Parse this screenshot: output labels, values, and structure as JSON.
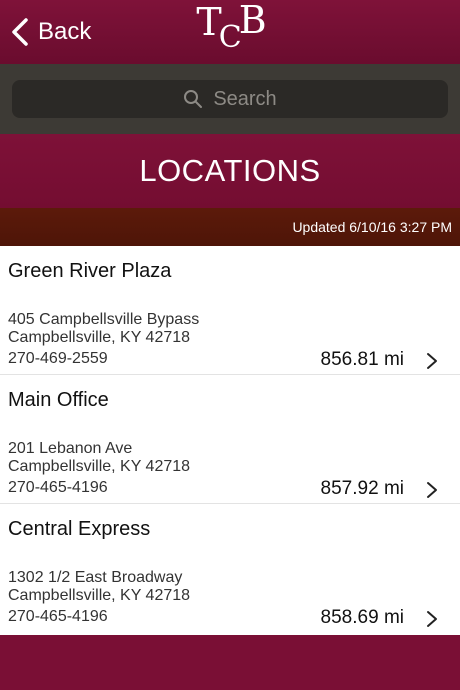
{
  "nav": {
    "back_label": "Back",
    "logo_letters": [
      "T",
      "C",
      "B"
    ]
  },
  "search": {
    "placeholder": "Search"
  },
  "title": "LOCATIONS",
  "updated": "Updated 6/10/16 3:27 PM",
  "locations": [
    {
      "name": "Green River Plaza",
      "address1": "405 Campbellsville Bypass",
      "address2": "Campbellsville, KY 42718",
      "phone": "270-469-2559",
      "distance": "856.81 mi"
    },
    {
      "name": "Main Office",
      "address1": "201 Lebanon Ave",
      "address2": "Campbellsville, KY 42718",
      "phone": "270-465-4196",
      "distance": "857.92 mi"
    },
    {
      "name": "Central Express",
      "address1": "1302 1/2 East Broadway",
      "address2": "Campbellsville, KY 42718",
      "phone": "270-465-4196",
      "distance": "858.69 mi"
    }
  ],
  "colors": {
    "brand": "#7a0f35",
    "search_bg": "#3d3a35",
    "updated_bg": "#561808"
  }
}
